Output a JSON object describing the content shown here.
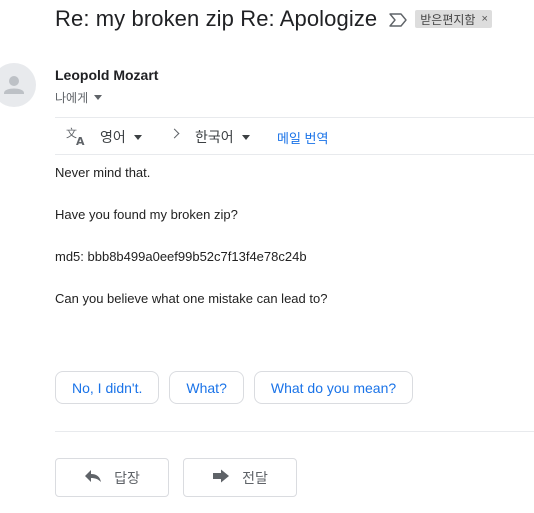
{
  "email": {
    "subject": "Re: my broken zip Re: Apologize",
    "label_chip": "받은편지함",
    "label_close": "×",
    "sender": "Leopold Mozart",
    "recipient": "나에게"
  },
  "translate": {
    "from_lang": "영어",
    "to_lang": "한국어",
    "link": "메일 번역"
  },
  "body_lines": [
    "Never mind that.",
    "Have you found my broken zip?",
    "md5: bbb8b499a0eef99b52c7f13f4e78c24b",
    "Can you believe what one mistake can lead to?"
  ],
  "smart_replies": [
    "No, I didn't.",
    "What?",
    "What do you mean?"
  ],
  "actions": {
    "reply": "답장",
    "forward": "전달"
  },
  "colors": {
    "link_blue": "#1a73e8",
    "chip_bg": "#dddddd",
    "muted": "#5f6368"
  },
  "icons": {
    "important": "important-marker-icon",
    "avatar": "person-icon",
    "translate": "translate-icon",
    "reply": "reply-arrow-icon",
    "forward": "forward-arrow-icon"
  }
}
